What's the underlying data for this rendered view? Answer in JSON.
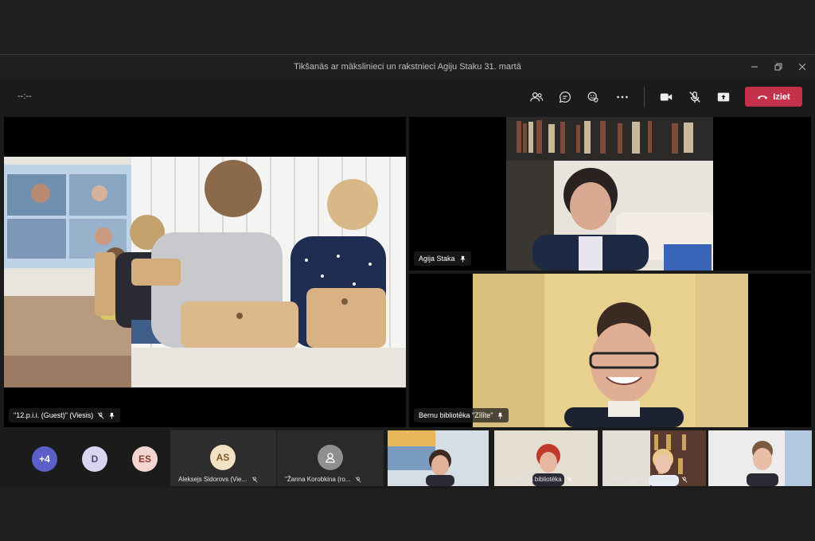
{
  "window": {
    "title": "Tikšanās ar mākslinieci un rakstnieci Agiju Staku 31. martā"
  },
  "toolbar": {
    "timer": "--:--",
    "leave_label": "Iziet",
    "icons": [
      "people-icon",
      "chat-icon",
      "reactions-icon",
      "more-icon",
      "camera-icon",
      "mic-muted-icon",
      "share-icon",
      "hangup-icon"
    ],
    "leave_color": "#c4314b"
  },
  "tiles": {
    "main": {
      "name": "\"12.p.i.i. (Guest)\" (Viesis)"
    },
    "agija": {
      "name": "Agija Staka"
    },
    "zilite": {
      "name": "Bernu bibliotēka \"Zīlīte\""
    }
  },
  "roster": {
    "overflow": "+4",
    "avatars": [
      {
        "initials": "D",
        "color": "#d8d5f0"
      },
      {
        "initials": "ES",
        "color": "#f4d6d0"
      }
    ],
    "tiles": [
      {
        "initials": "AS",
        "name": "Aleksejs Sidorovs (Vie..."
      },
      {
        "initials": "",
        "name": "\"Žanna Korobkina (ro..."
      },
      {
        "name": ""
      },
      {
        "name": "Jaunbuves bibliotēka"
      },
      {
        "name": "Pārdaugavas bibliotēka"
      },
      {
        "name": ""
      }
    ]
  }
}
